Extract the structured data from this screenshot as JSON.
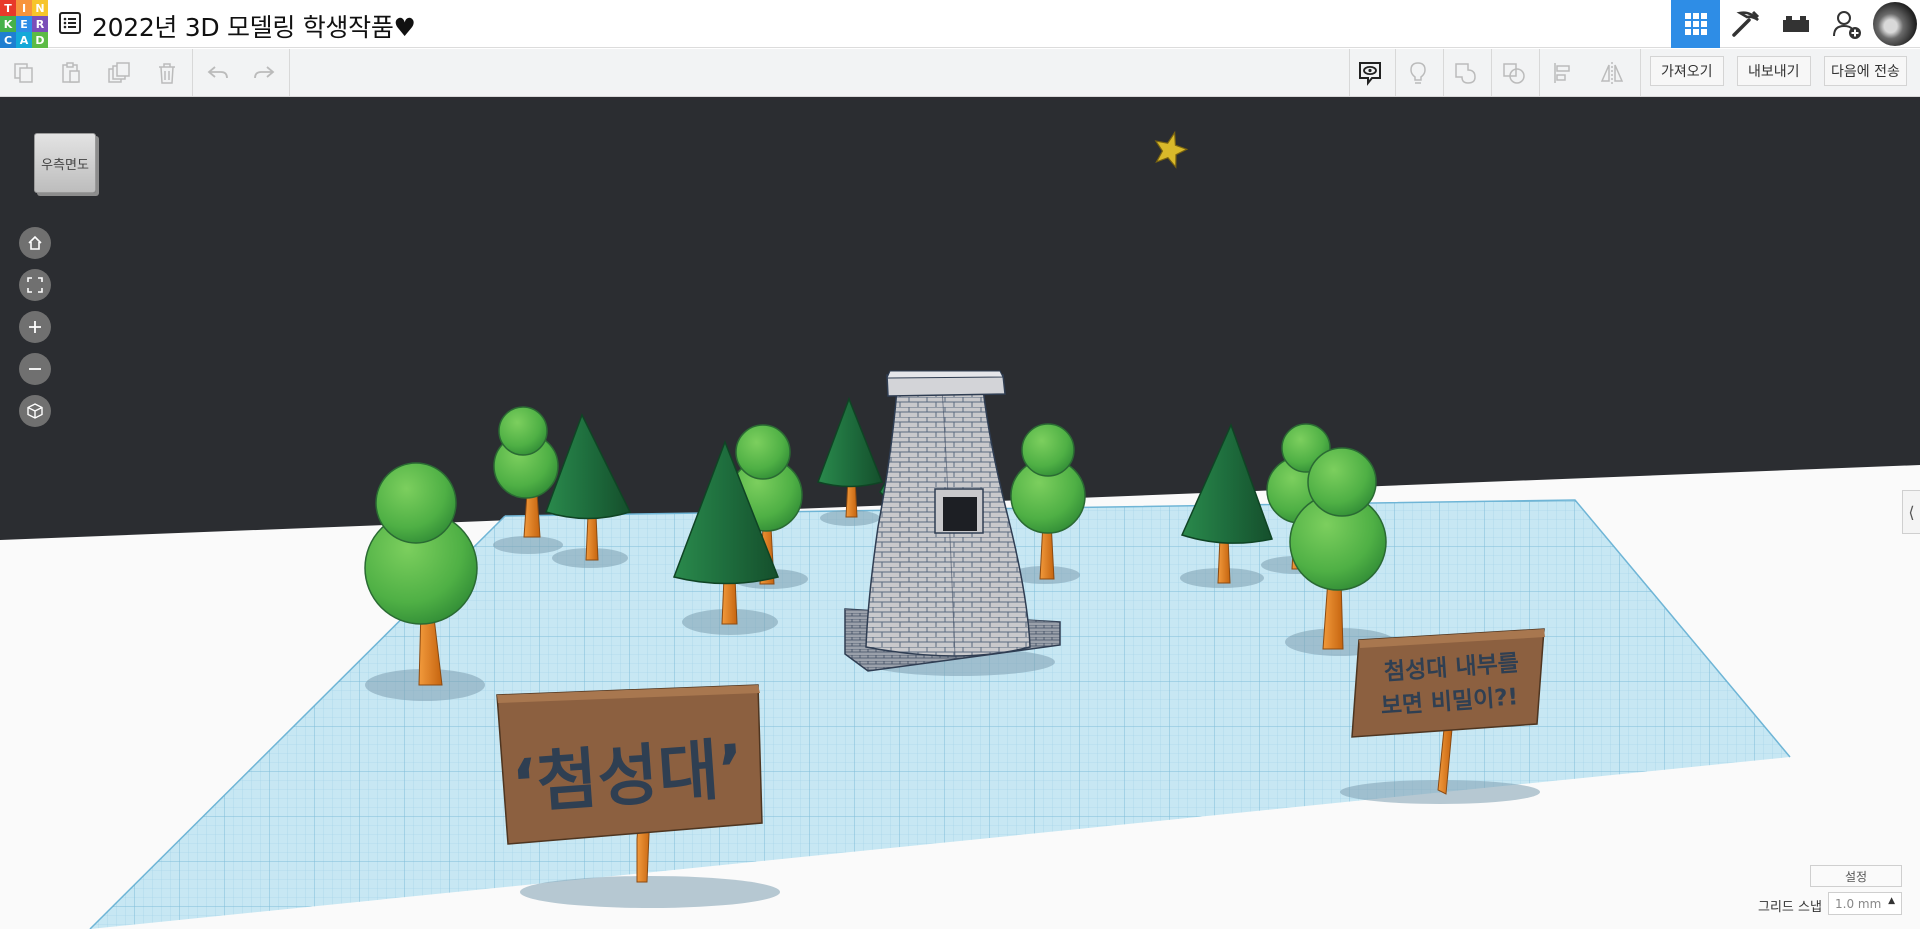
{
  "app": {
    "logo_letters": [
      "T",
      "I",
      "N",
      "K",
      "E",
      "R",
      "C",
      "A",
      "D"
    ],
    "project_title": "2022년 3D 모델링 학생작품♥"
  },
  "header": {
    "buttons": [
      {
        "name": "3d-design-view",
        "icon": "grid-icon",
        "active": true
      },
      {
        "name": "codeblocks-view",
        "icon": "pickaxe-icon",
        "active": false
      },
      {
        "name": "bricks-view",
        "icon": "brick-icon",
        "active": false
      },
      {
        "name": "invite-user",
        "icon": "add-user-icon",
        "active": false
      }
    ]
  },
  "toolbar": {
    "import_label": "가져오기",
    "export_label": "내보내기",
    "send_to_label": "다음에 전송"
  },
  "viewport": {
    "viewcube_label": "우측면도",
    "sign_main": "‘첨성대’",
    "sign_secondary_line1": "첨성대 내부를",
    "sign_secondary_line2": "보면 비밀이?!",
    "settings_label": "설정",
    "grid_snap_label": "그리드 스냅",
    "grid_snap_value": "1.0 mm"
  },
  "colors": {
    "accent": "#2e8de6",
    "logo": [
      "#e8392a",
      "#f7943c",
      "#f7c52a",
      "#46b14a",
      "#2e8de6",
      "#7b4fb8",
      "#1f7fd1",
      "#14a9d8",
      "#5dbb46"
    ],
    "sky": "#2b2d31",
    "workplane": "#bfe3f1",
    "tree_leaf": "#55b84a",
    "pine": "#1d6b3c",
    "trunk": "#e07c1f",
    "sign_board": "#9a6b47"
  }
}
